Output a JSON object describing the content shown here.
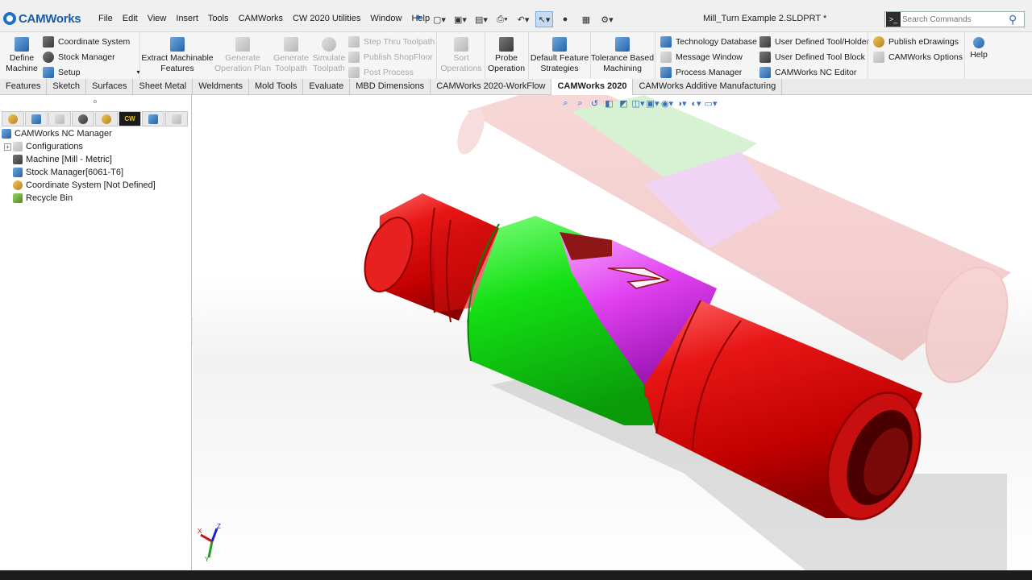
{
  "app": {
    "logo_text": "CAMWorks",
    "document_title": "Mill_Turn Example 2.SLDPRT *"
  },
  "menu": [
    "File",
    "Edit",
    "View",
    "Insert",
    "Tools",
    "CAMWorks",
    "CW 2020 Utilities",
    "Window",
    "Help"
  ],
  "search": {
    "placeholder": "Search Commands"
  },
  "ribbon": {
    "define_machine": "Define\nMachine",
    "col1": [
      "Coordinate System",
      "Stock Manager",
      "Setup"
    ],
    "extract": "Extract Machinable\nFeatures",
    "generate_plan": "Generate\nOperation Plan",
    "generate_toolpath": "Generate\nToolpath",
    "simulate_toolpath": "Simulate\nToolpath",
    "col2": [
      "Step Thru Toolpath",
      "Publish ShopFloor",
      "Post Process"
    ],
    "sort": "Sort\nOperations",
    "probe": "Probe\nOperation",
    "default_strategies": "Default Feature\nStrategies",
    "tolerance": "Tolerance Based\nMachining",
    "col3": [
      "Technology Database",
      "Message Window",
      "Process Manager"
    ],
    "col4": [
      "User Defined Tool/Holder",
      "User Defined Tool Block",
      "CAMWorks NC Editor"
    ],
    "col5": [
      "Publish eDrawings",
      "CAMWorks Options"
    ],
    "help": "Help"
  },
  "tabs": [
    "Features",
    "Sketch",
    "Surfaces",
    "Sheet Metal",
    "Weldments",
    "Mold Tools",
    "Evaluate",
    "MBD Dimensions",
    "CAMWorks 2020-WorkFlow",
    "CAMWorks 2020",
    "CAMWorks Additive Manufacturing"
  ],
  "active_tab": "CAMWorks 2020",
  "feature_manager": {
    "active_tab_label": "CW",
    "tree": [
      "CAMWorks NC Manager",
      "Configurations",
      "Machine [Mill - Metric]",
      "Stock Manager[6061-T6]",
      "Coordinate System [Not Defined]",
      "Recycle Bin"
    ]
  },
  "triad": {
    "x": "X",
    "y": "Y",
    "z": "Z"
  },
  "colors": {
    "stock_red": "#e01a1a",
    "feature_green": "#18e018",
    "feature_magenta": "#e040f0",
    "accent_blue": "#1a5ca8"
  }
}
